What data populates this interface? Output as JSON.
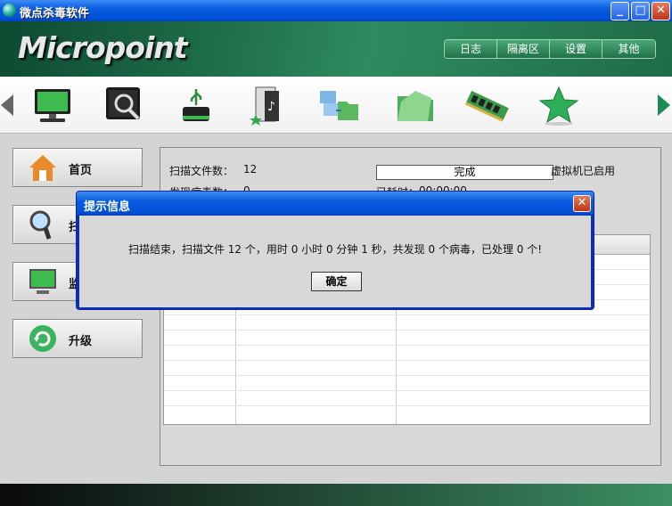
{
  "window": {
    "title": "微点杀毒软件"
  },
  "header": {
    "logo": "Micropoint",
    "nav": [
      "日志",
      "隔离区",
      "设置",
      "其他"
    ]
  },
  "toolbar": {
    "tools": [
      "monitor-icon",
      "scan-disk-icon",
      "usb-drive-icon",
      "music-file-icon",
      "network-folders-icon",
      "folder-icon",
      "memory-chip-icon",
      "star-icon"
    ]
  },
  "sidebar": {
    "items": [
      {
        "label": "首页",
        "icon": "home-icon"
      },
      {
        "label": "扫",
        "icon": "magnifier-icon"
      },
      {
        "label": "监",
        "icon": "monitor-icon"
      },
      {
        "label": "升级",
        "icon": "refresh-icon"
      }
    ]
  },
  "scan": {
    "files_label": "扫描文件数：",
    "files_value": "12",
    "progress_text": "完成",
    "progress_fraction": 1.0,
    "vm_status": "虚拟机已启用",
    "found_label": "发现病毒数：",
    "found_value": "0",
    "elapsed_label": "已耗时：",
    "elapsed_value": "00:00:00"
  },
  "dialog": {
    "title": "提示信息",
    "message": "扫描结束，扫描文件 12 个，用时 0 小时 0 分钟 1 秒，共发现 0 个病毒，已处理 0 个!",
    "ok_label": "确定"
  },
  "colors": {
    "accent_green": "#1d6b47",
    "xp_blue": "#0a5be0"
  }
}
